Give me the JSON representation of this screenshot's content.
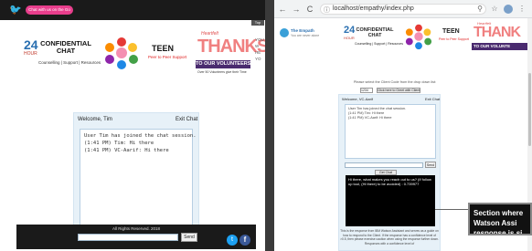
{
  "left": {
    "top_pill": "Chat with us on the Go",
    "scroll_hint": "Top",
    "cc_number": "24",
    "cc_hour": "HOUR",
    "cc_title": "CONFIDENTIAL CHAT",
    "cc_sub": "Counselling | Support | Resources",
    "teen_title": "TEEN",
    "teen_sub": "Peer to Peer Support",
    "thanks_small": "Heartfelt",
    "thanks_big": "THANKS",
    "thanks_vol": "TO OUR VOLUNTEERS!",
    "thanks_note": "Over 50 Volunteers give their Time",
    "side_text": [
      "YOU",
      "W",
      "HE",
      "YO"
    ],
    "chat": {
      "welcome": "Welcome, Tim",
      "exit": "Exit Chat",
      "log": [
        "User Tim has joined the chat session.",
        "(1:41 PM) Tim: Hi there",
        "(1:41 PM) VC-Aarif: Hi there"
      ],
      "send": "Send"
    },
    "footer": "All Rights Reserved. 2018",
    "twitter_glyph": "t",
    "facebook_glyph": "f"
  },
  "browser": {
    "back": "←",
    "forward": "→",
    "reload": "C",
    "info": "ⓘ",
    "url": "localhost/empathy/index.php",
    "zoom_icon": "⚲",
    "star_icon": "☆",
    "menu_icon": "⋮"
  },
  "right": {
    "emp_title": "The Empath",
    "emp_sub": "You are never alone",
    "cc_number": "24",
    "cc_hour": "HOUR",
    "cc_title": "CONFIDENTIAL CHAT",
    "cc_sub": "Counselling | Support | Resources",
    "teen_title": "TEEN",
    "teen_sub": "Peer to Peer Support",
    "thanks_small": "Heartfelt",
    "thanks_big": "THANK",
    "thanks_vol": "TO OUR VOLUNTE",
    "select_text": "Please select the Client Code from the drop down list:",
    "select_value": "1234",
    "greet_btn": "Click here to Greet with Client",
    "chat": {
      "welcome": "Welcome, VC-Aarif",
      "exit": "Exit Chat",
      "log": [
        "User Tim has joined the chat session.",
        "(1:41 PM) Tim: Hi there",
        "(1:41 PM) VC-Aarif: Hi there"
      ],
      "send": "Send",
      "suggest_btn": "Get Chat",
      "watson_text": "Hi there, what makes you reach out to us? (If follow up tool, (Hi there) to be avoided) : 0.739977",
      "footnote": "This is the response from IBM Watson Assistant and serves as a guide on how to respond to the Client. If the response has a confidence level of >0.5, then please exercise caution when using the response further down. Responses with a confidence level of"
    },
    "callout": [
      "Section where",
      "Watson Assi",
      "response is si"
    ]
  }
}
